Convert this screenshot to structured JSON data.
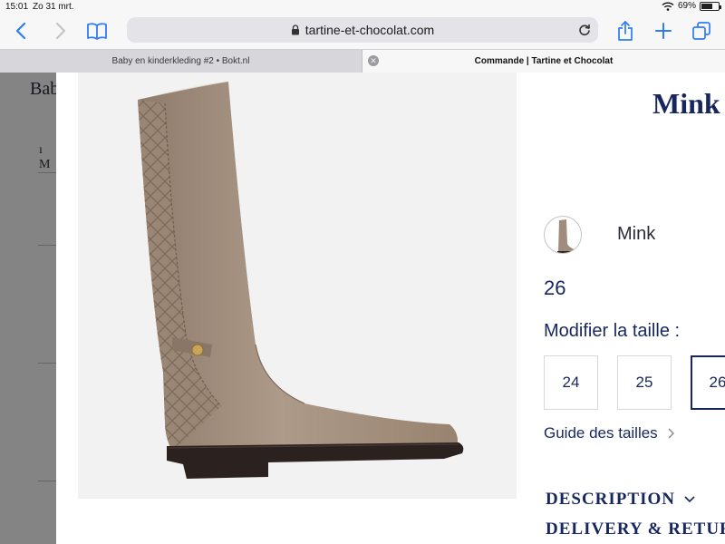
{
  "status_bar": {
    "time": "15:01",
    "date": "Zo 31 mrt.",
    "battery": "69%",
    "battery_level": 0.69
  },
  "browser": {
    "url": "tartine-et-chocolat.com",
    "tabs": [
      {
        "title": "Baby en kinderkleding #2 • Bokt.nl"
      },
      {
        "title": "Commande | Tartine et Chocolat"
      }
    ],
    "icons": [
      "back-icon",
      "forward-icon",
      "bookmarks-icon",
      "lock-icon",
      "reload-icon",
      "share-icon",
      "add-tab-icon",
      "tabs-overview-icon"
    ]
  },
  "background_page": {
    "heading_fragment": "Bab",
    "small_text": "ı M"
  },
  "product": {
    "title": "Mink",
    "color_name": "Mink",
    "selected_size": "26",
    "modify_size_label": "Modifier la taille :",
    "sizes": [
      "24",
      "25",
      "26"
    ],
    "active_size": "26",
    "size_guide": "Guide des tailles",
    "description": "DESCRIPTION",
    "delivery": "DELIVERY & RETURNS"
  },
  "colors": {
    "navy": "#17275e",
    "boot_suede": "#a08c7b",
    "sole": "#2b2220"
  }
}
